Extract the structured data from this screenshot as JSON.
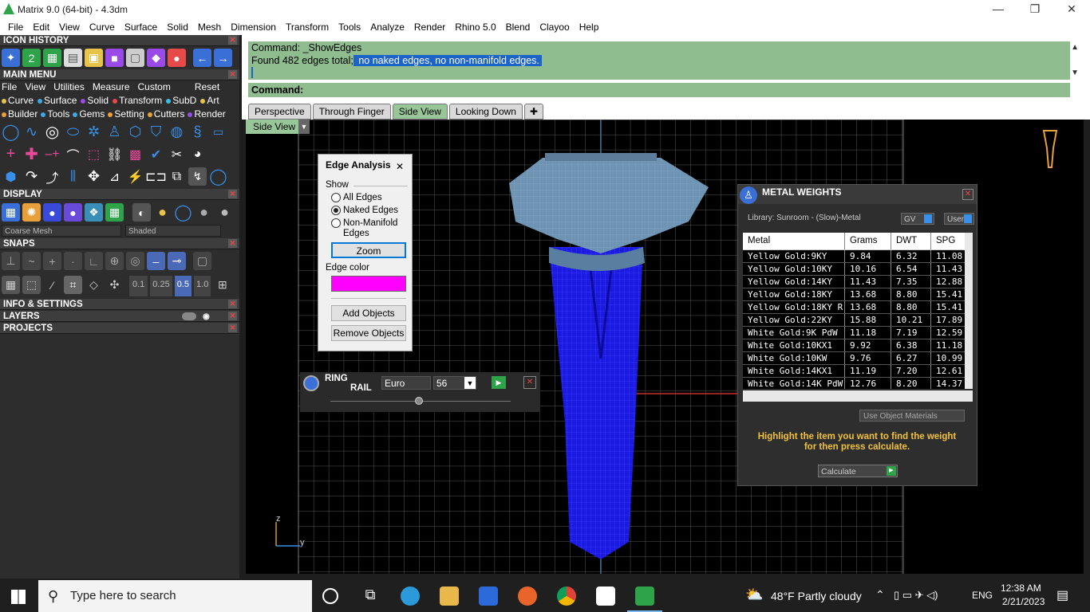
{
  "window": {
    "title": "Matrix 9.0 (64-bit) - 4.3dm",
    "minimize": "—",
    "restore": "❐",
    "close": "✕"
  },
  "menubar": [
    "File",
    "Edit",
    "View",
    "Curve",
    "Surface",
    "Solid",
    "Mesh",
    "Dimension",
    "Transform",
    "Tools",
    "Analyze",
    "Render",
    "Rhino 5.0",
    "Blend",
    "Clayoo",
    "Help"
  ],
  "left_panel": {
    "icon_history": "ICON HISTORY",
    "main_menu": "MAIN MENU",
    "main_menu_items": [
      "File",
      "View",
      "Utilities",
      "Measure",
      "Custom"
    ],
    "reset": "Reset",
    "row1": [
      {
        "label": "Curve",
        "color": "#e8c34a"
      },
      {
        "label": "Surface",
        "color": "#3aa6e8"
      },
      {
        "label": "Solid",
        "color": "#9a4ae8"
      },
      {
        "label": "Transform",
        "color": "#e84a4a"
      },
      {
        "label": "SubD",
        "color": "#3ac0e8"
      },
      {
        "label": "Art",
        "color": "#e8c34a"
      }
    ],
    "row2": [
      {
        "label": "Builder",
        "color": "#e8a03a"
      },
      {
        "label": "Tools",
        "color": "#3aa6e8"
      },
      {
        "label": "Gems",
        "color": "#3aa6e8"
      },
      {
        "label": "Setting",
        "color": "#e8a03a"
      },
      {
        "label": "Cutters",
        "color": "#e8a03a"
      },
      {
        "label": "Render",
        "color": "#9a4ae8"
      }
    ],
    "display": "DISPLAY",
    "display_mode_left": "Coarse Mesh",
    "display_mode_right": "Shaded",
    "snaps": "SNAPS",
    "snap_values": [
      "0.1",
      "0.25",
      "0.5",
      "1.0"
    ],
    "info": "INFO & SETTINGS",
    "layers": "LAYERS",
    "projects": "PROJECTS"
  },
  "command": {
    "line1": "Command: _ShowEdges",
    "line2_prefix": "Found 482 edges total;",
    "line2_highlight": " no naked edges, no non-manifold edges. ",
    "prompt": "Command:"
  },
  "tabs": [
    "Perspective",
    "Through Finger",
    "Side View",
    "Looking Down"
  ],
  "viewport": {
    "label": "Side View",
    "axis_z": "z",
    "axis_y": "y"
  },
  "edge_analysis": {
    "title": "Edge Analysis",
    "show_label": "Show",
    "options": [
      "All Edges",
      "Naked Edges",
      "Non-Manifold Edges"
    ],
    "selected": "Naked Edges",
    "zoom": "Zoom",
    "edge_color_label": "Edge color",
    "edge_color": "#ff00ff",
    "add_objects": "Add Objects",
    "remove_objects": "Remove Objects"
  },
  "ring_rail": {
    "title_line1": "RING",
    "title_line2": "RAIL",
    "standard": "Euro",
    "size": "56"
  },
  "metal_weights": {
    "title": "METAL WEIGHTS",
    "library": "Library: Sunroom - (Slow)-Metal",
    "gv": "GV",
    "user": "User",
    "columns": [
      "Metal",
      "Grams",
      "DWT",
      "SPG"
    ],
    "rows": [
      [
        "Yellow Gold:9KY",
        "9.84",
        "6.32",
        "11.08"
      ],
      [
        "Yellow Gold:10KY",
        "10.16",
        "6.54",
        "11.43"
      ],
      [
        "Yellow Gold:14KY",
        "11.43",
        "7.35",
        "12.88"
      ],
      [
        "Yellow Gold:18KY",
        "13.68",
        "8.80",
        "15.41"
      ],
      [
        "Yellow Gold:18KY R...",
        "13.68",
        "8.80",
        "15.41"
      ],
      [
        "Yellow Gold:22KY",
        "15.88",
        "10.21",
        "17.89"
      ],
      [
        "White Gold:9K PdW",
        "11.18",
        "7.19",
        "12.59"
      ],
      [
        "White Gold:10KX1",
        "9.92",
        "6.38",
        "11.18"
      ],
      [
        "White Gold:10KW",
        "9.76",
        "6.27",
        "10.99"
      ],
      [
        "White Gold:14KX1",
        "11.19",
        "7.20",
        "12.61"
      ],
      [
        "White Gold:14K PdW",
        "12.76",
        "8.20",
        "14.37"
      ]
    ],
    "use_object_materials": "Use Object Materials",
    "hint": "Highlight the item you want to find the weight for then press calculate.",
    "calculate": "Calculate"
  },
  "taskbar": {
    "search_placeholder": "Type here to search",
    "weather": "48°F  Partly cloudy",
    "language": "ENG",
    "time": "12:38 AM",
    "date": "2/21/2023"
  }
}
